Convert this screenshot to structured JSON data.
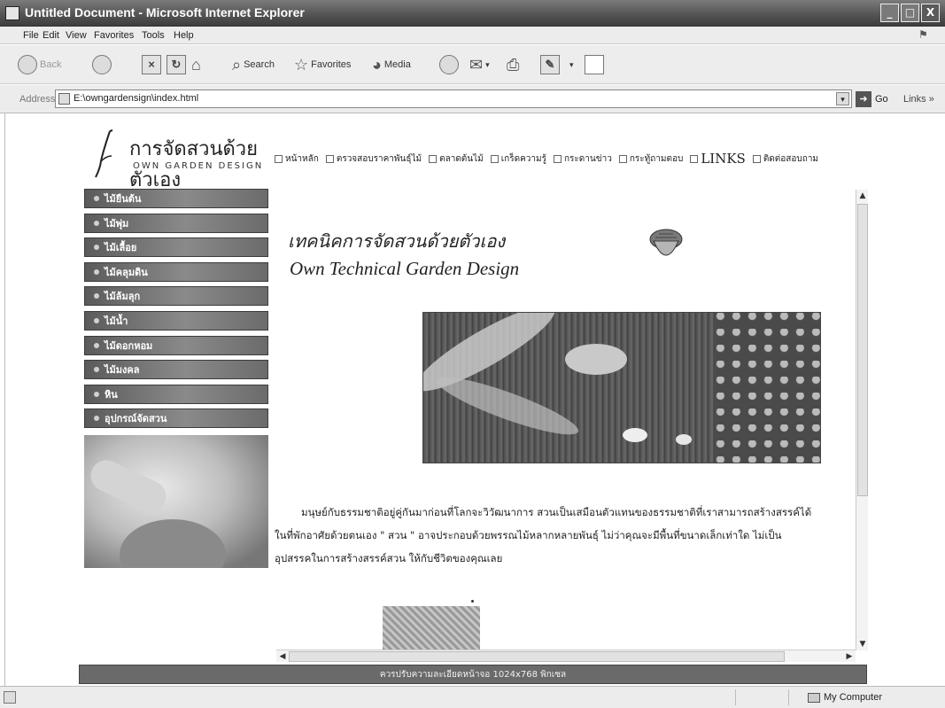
{
  "window": {
    "title": "Untitled Document - Microsoft Internet Explorer",
    "minimize": "_",
    "maximize": "□",
    "close": "X"
  },
  "menu": [
    "File",
    "Edit",
    "View",
    "Favorites",
    "Tools",
    "Help"
  ],
  "toolbar": {
    "back": "Back",
    "search": "Search",
    "favorites": "Favorites",
    "media": "Media"
  },
  "address": {
    "label": "Address",
    "value": "E:\\owngardensign\\index.html",
    "go": "Go",
    "links": "Links"
  },
  "logo": {
    "thai": "การจัดสวนด้วยตัวเอง",
    "english": "OWN GARDEN DESIGN"
  },
  "header_nav": [
    "หน้าหลัก",
    "ตรวจสอบราคาพันธุ์ไม้",
    "ตลาดต้นไม้",
    "เกร็ดความรู้",
    "กระดานข่าว",
    "กระทู้ถามตอบ",
    "LINKS",
    "ติดต่อสอบถาม"
  ],
  "left_menu": [
    "ไม้ยืนต้น",
    "ไม้พุ่ม",
    "ไม้เลื้อย",
    "ไม้คลุมดิน",
    "ไม้ล้มลุก",
    "ไม้น้ำ",
    "ไม้ดอกหอม",
    "ไม้มงคล",
    "หิน",
    "อุปกรณ์จัดสวน"
  ],
  "main": {
    "title_th": "เทคนิคการจัดสวนด้วยตัวเอง",
    "title_en": "Own Technical Garden Design",
    "paragraph": "มนุษย์กับธรรมชาติอยู่คู่กันมาก่อนที่โลกจะวิวัฒนาการ สวนเป็นเสมือนตัวแทนของธรรมชาติที่เราสามารถสร้างสรรค์ได้ในที่พักอาศัยด้วยตนเอง \" สวน \" อาจประกอบด้วยพรรณไม้หลากหลายพันธุ์ ไม่ว่าคุณจะมีพื้นที่ขนาดเล็กเท่าใด ไม่เป็นอุปสรรคในการสร้างสรรค์สวน ให้กับชีวิตของคุณเลย"
  },
  "footer": {
    "text": "ควรปรับความละเอียดหน้าจอ 1024x768 พิกเซล"
  },
  "status": {
    "zone": "My Computer"
  }
}
